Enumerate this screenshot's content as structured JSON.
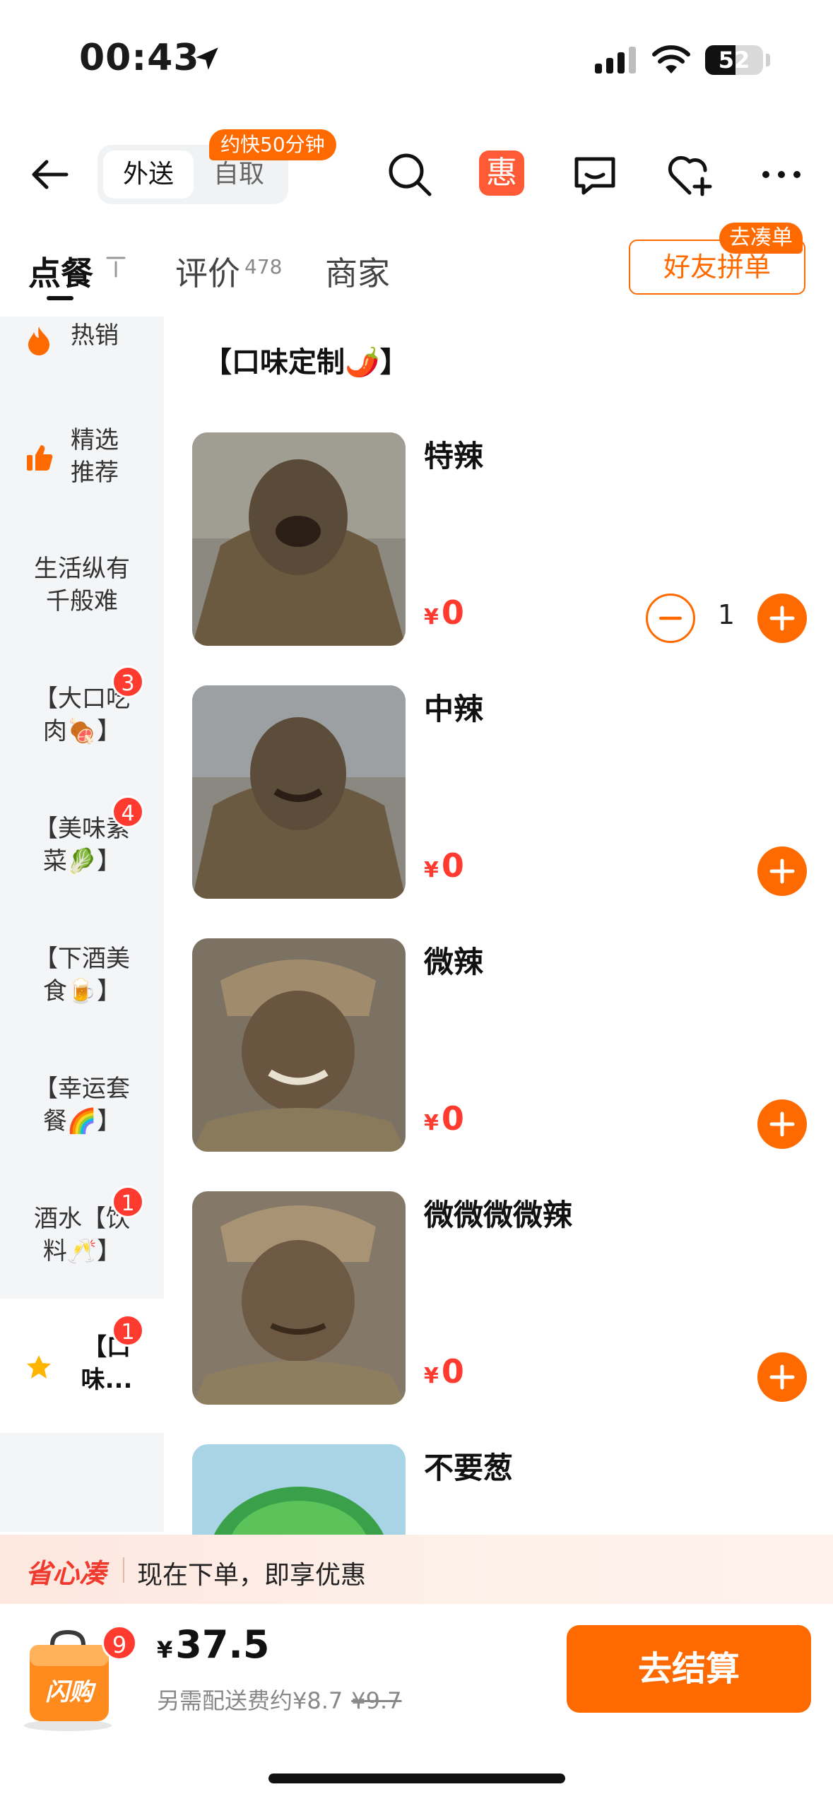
{
  "status": {
    "time": "00:43",
    "battery": "52",
    "battery_level": 0.52
  },
  "header": {
    "mode_delivery": "外送",
    "mode_pickup": "自取",
    "eta_badge": "约快50分钟",
    "hui_label": "惠"
  },
  "tabs": {
    "order": "点餐",
    "reviews": "评价",
    "reviews_count": "478",
    "merchant": "商家",
    "group_button": "好友拼单",
    "group_badge": "去凑单"
  },
  "sidebar": {
    "items": [
      {
        "label": "热销",
        "icon": "fire-icon"
      },
      {
        "label": "精选\n推荐",
        "icon": "thumbs-up-icon"
      },
      {
        "label": "生活纵有\n千般难"
      },
      {
        "label": "【大口吃\n肉🍖】",
        "badge": "3"
      },
      {
        "label": "【美味素\n菜🥬】",
        "badge": "4"
      },
      {
        "label": "【下酒美\n食🍺】"
      },
      {
        "label": "【幸运套\n餐🌈】"
      },
      {
        "label": "酒水【饮\n料🥂】",
        "badge": "1"
      },
      {
        "label": "【口\n味...",
        "badge": "1",
        "icon": "star-icon",
        "active": true
      }
    ]
  },
  "section": {
    "title": "【口味定制🌶️】"
  },
  "items": [
    {
      "name": "特辣",
      "currency": "¥",
      "price": "0",
      "qty": "1"
    },
    {
      "name": "中辣",
      "currency": "¥",
      "price": "0"
    },
    {
      "name": "微辣",
      "currency": "¥",
      "price": "0"
    },
    {
      "name": "微微微微辣",
      "currency": "¥",
      "price": "0"
    },
    {
      "name": "不要葱"
    }
  ],
  "promo": {
    "brand": "省心凑",
    "text": "现在下单，即享优惠"
  },
  "cart": {
    "count": "9",
    "logo_text": "闪购",
    "currency": "¥",
    "total": "37.5",
    "fee_text": "另需配送费约¥8.7",
    "fee_original": "¥9.7",
    "checkout": "去结算"
  },
  "colors": {
    "accent": "#ff6a00",
    "price": "#ff3b30",
    "badge": "#ff3b30",
    "sidebar_bg": "#f4f5f7"
  }
}
